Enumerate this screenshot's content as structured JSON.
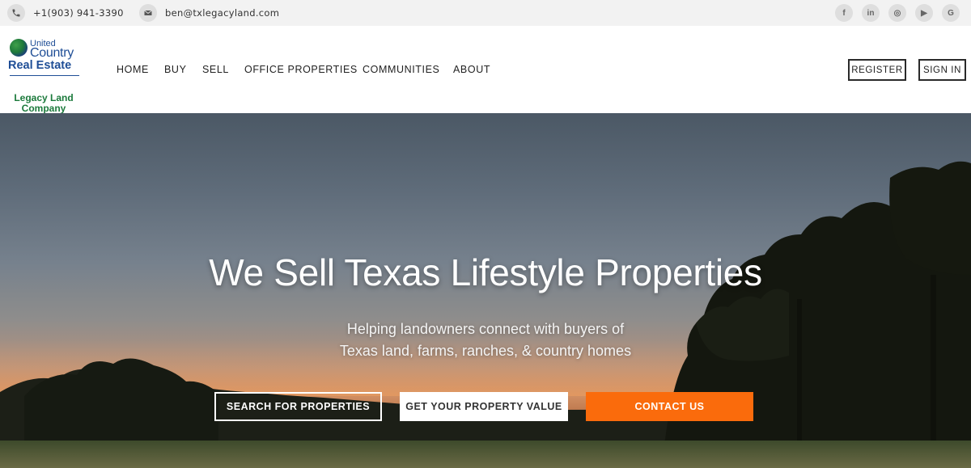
{
  "topbar": {
    "phone": "+1(903) 941-3390",
    "email": "ben@txlegacyland.com",
    "icons": [
      "phone-icon",
      "email-icon"
    ],
    "social": [
      {
        "name": "facebook-icon",
        "glyph": "f"
      },
      {
        "name": "linkedin-icon",
        "glyph": "in"
      },
      {
        "name": "instagram-icon",
        "glyph": "◎"
      },
      {
        "name": "youtube-icon",
        "glyph": "▶"
      },
      {
        "name": "google-icon",
        "glyph": "G"
      }
    ]
  },
  "logo": {
    "line1": "United",
    "line2": "Country",
    "line3": "Real Estate",
    "line4": "Legacy Land",
    "line5": "Company"
  },
  "nav": {
    "items": [
      "HOME",
      "BUY",
      "SELL",
      "OFFICE PROPERTIES",
      "COMMUNITIES",
      "ABOUT"
    ],
    "register": "REGISTER",
    "signin": "SIGN IN"
  },
  "hero": {
    "title": "We Sell Texas Lifestyle Properties",
    "subtitle_line1": "Helping landowners connect with buyers of",
    "subtitle_line2": "Texas land, farms, ranches, & country homes",
    "buttons": {
      "search": "SEARCH FOR PROPERTIES",
      "value": "GET YOUR PROPERTY VALUE",
      "contact": "CONTACT US"
    }
  },
  "colors": {
    "accent": "#fa6b0c",
    "logo_blue": "#1f4e96",
    "logo_green": "#1c7a3c"
  }
}
